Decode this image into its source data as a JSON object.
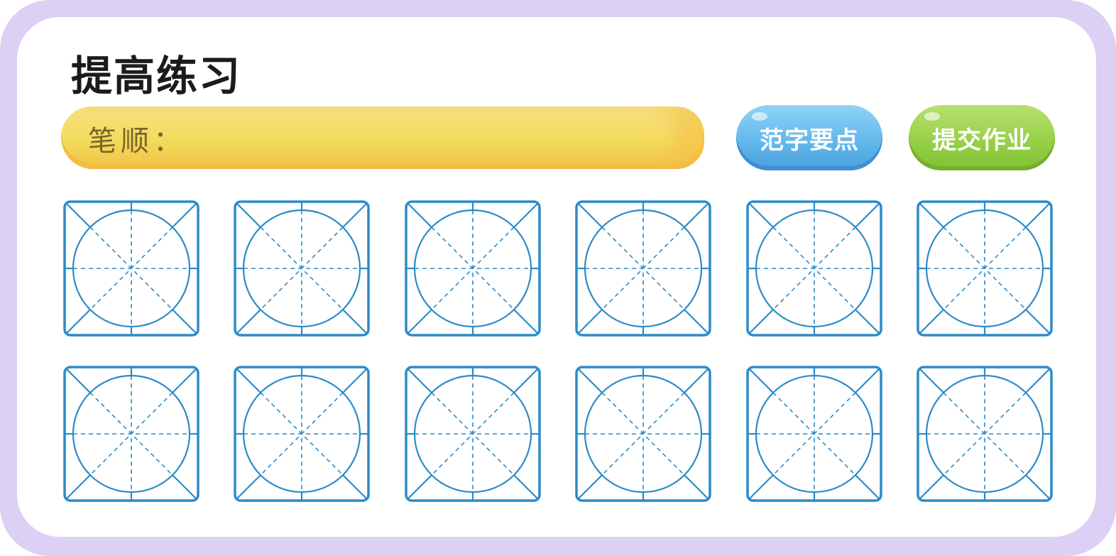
{
  "page": {
    "title": "提高练习",
    "stroke_order_label": "笔顺："
  },
  "buttons": {
    "model_points": "范字要点",
    "submit_homework": "提交作业"
  },
  "grid": {
    "rows": 2,
    "cols": 6,
    "line_color": "#2b8bc8"
  },
  "colors": {
    "frame": "#ddd0f5",
    "stroke_bar": "#f4da5a",
    "button_blue": "#5fb6ea",
    "button_green": "#94cf45"
  }
}
